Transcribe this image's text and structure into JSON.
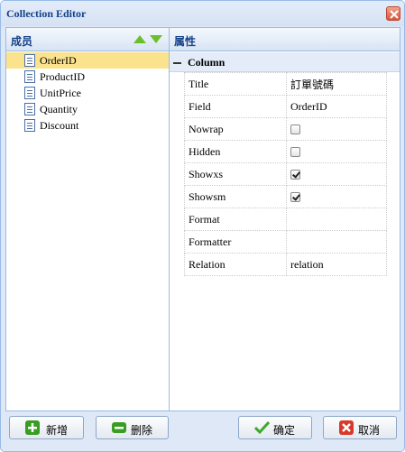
{
  "window": {
    "title": "Collection Editor"
  },
  "members_panel": {
    "title": "成员",
    "items": [
      "OrderID",
      "ProductID",
      "UnitPrice",
      "Quantity",
      "Discount"
    ],
    "selected": "OrderID"
  },
  "properties_panel": {
    "title": "属性",
    "group": "Column",
    "rows": [
      {
        "name": "Title",
        "type": "text",
        "value": "訂單號碼"
      },
      {
        "name": "Field",
        "type": "text",
        "value": "OrderID"
      },
      {
        "name": "Nowrap",
        "type": "checkbox",
        "checked": false
      },
      {
        "name": "Hidden",
        "type": "checkbox",
        "checked": false
      },
      {
        "name": "Showxs",
        "type": "checkbox",
        "checked": true
      },
      {
        "name": "Showsm",
        "type": "checkbox",
        "checked": true
      },
      {
        "name": "Format",
        "type": "text",
        "value": ""
      },
      {
        "name": "Formatter",
        "type": "text",
        "value": ""
      },
      {
        "name": "Relation",
        "type": "text",
        "value": "relation"
      }
    ]
  },
  "footer": {
    "add_label": "新增",
    "remove_label": "删除",
    "ok_label": "确定",
    "cancel_label": "取消"
  },
  "colors": {
    "accent": "#15428b",
    "selected_row": "#fbe38e",
    "arrow": "#6cbf2c"
  },
  "icons": {
    "close": "close-icon",
    "move_up": "arrow-up-icon",
    "move_down": "arrow-down-icon",
    "member": "document-icon",
    "add": "plus-icon",
    "remove": "minus-icon",
    "ok": "check-icon",
    "cancel": "x-icon"
  }
}
